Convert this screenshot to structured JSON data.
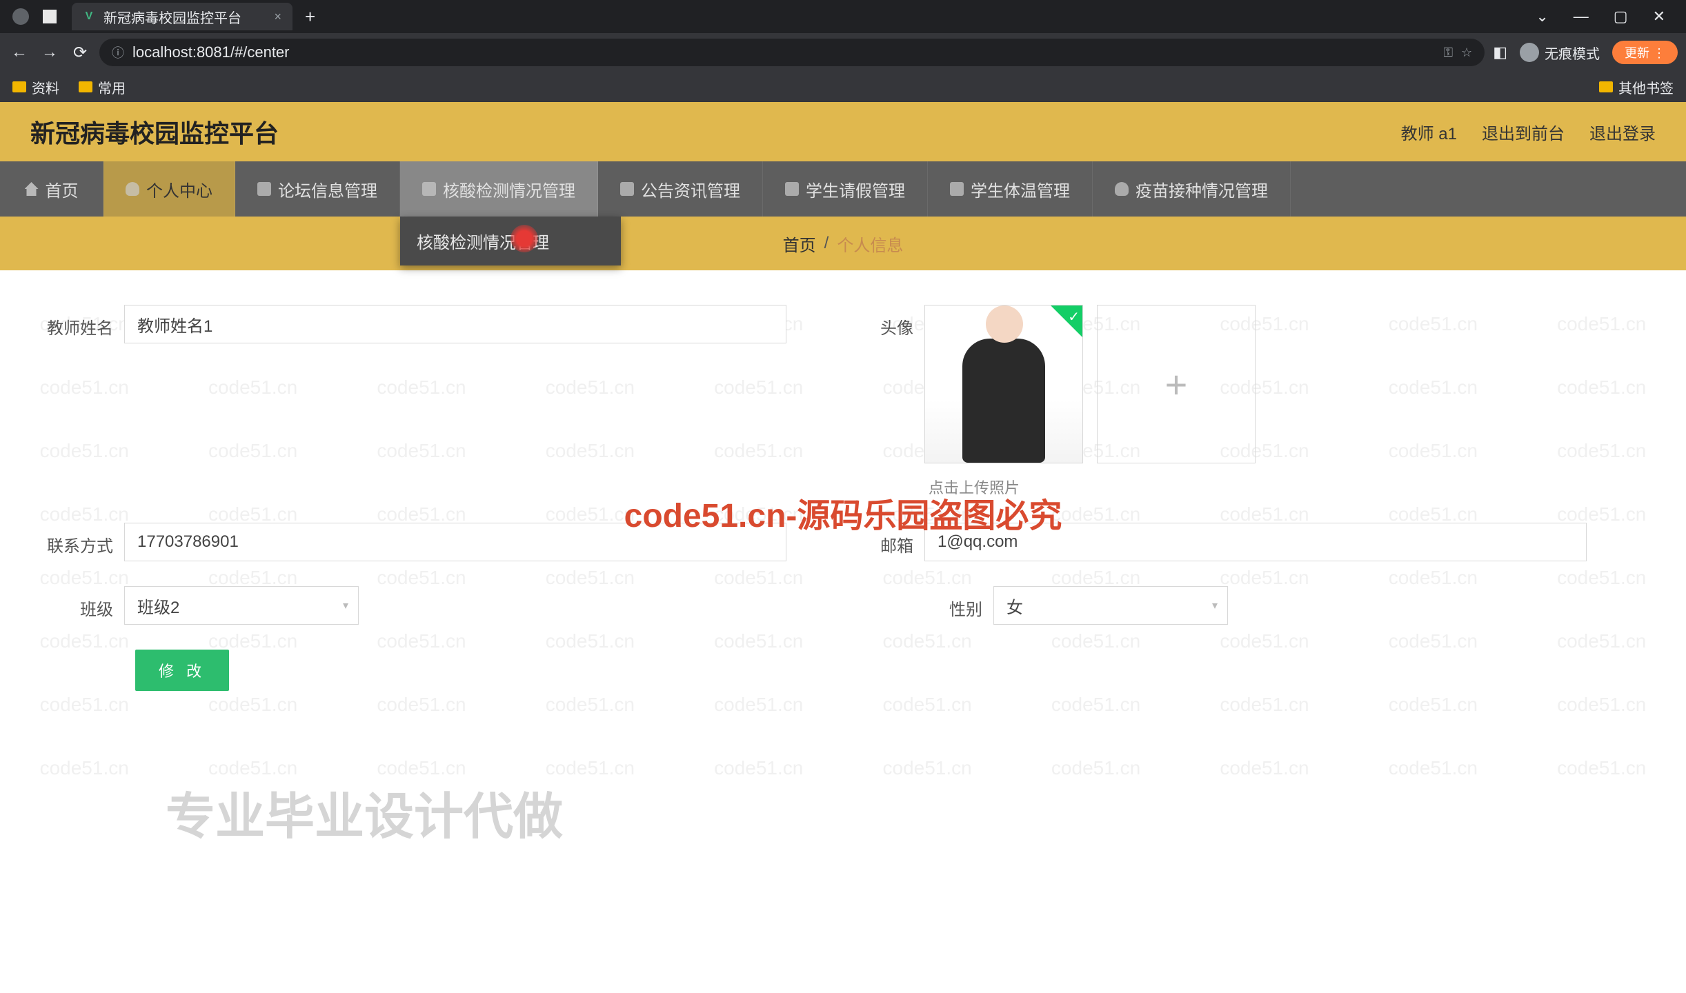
{
  "browser": {
    "tab_title": "新冠病毒校园监控平台",
    "url": "localhost:8081/#/center",
    "incognito_label": "无痕模式",
    "update_label": "更新"
  },
  "bookmarks": {
    "items": [
      "资料",
      "常用"
    ],
    "other": "其他书签"
  },
  "header": {
    "site_title": "新冠病毒校园监控平台",
    "user_label": "教师 a1",
    "logout_front": "退出到前台",
    "logout": "退出登录"
  },
  "nav": {
    "items": [
      {
        "label": "首页"
      },
      {
        "label": "个人中心"
      },
      {
        "label": "论坛信息管理"
      },
      {
        "label": "核酸检测情况管理"
      },
      {
        "label": "公告资讯管理"
      },
      {
        "label": "学生请假管理"
      },
      {
        "label": "学生体温管理"
      },
      {
        "label": "疫苗接种情况管理"
      }
    ],
    "dropdown_label": "核酸检测情况管理"
  },
  "breadcrumb": {
    "home": "首页",
    "sep": "/",
    "current": "个人信息"
  },
  "form": {
    "teacher_name_label": "教师姓名",
    "teacher_name_value": "教师姓名1",
    "avatar_label": "头像",
    "upload_hint": "点击上传照片",
    "phone_label": "联系方式",
    "phone_value": "17703786901",
    "email_label": "邮箱",
    "email_value": "1@qq.com",
    "class_label": "班级",
    "class_value": "班级2",
    "gender_label": "性别",
    "gender_value": "女",
    "submit_label": "修 改"
  },
  "watermark": {
    "text": "code51.cn",
    "center": "code51.cn-源码乐园盗图必究",
    "corner": "专业毕业设计代做"
  }
}
